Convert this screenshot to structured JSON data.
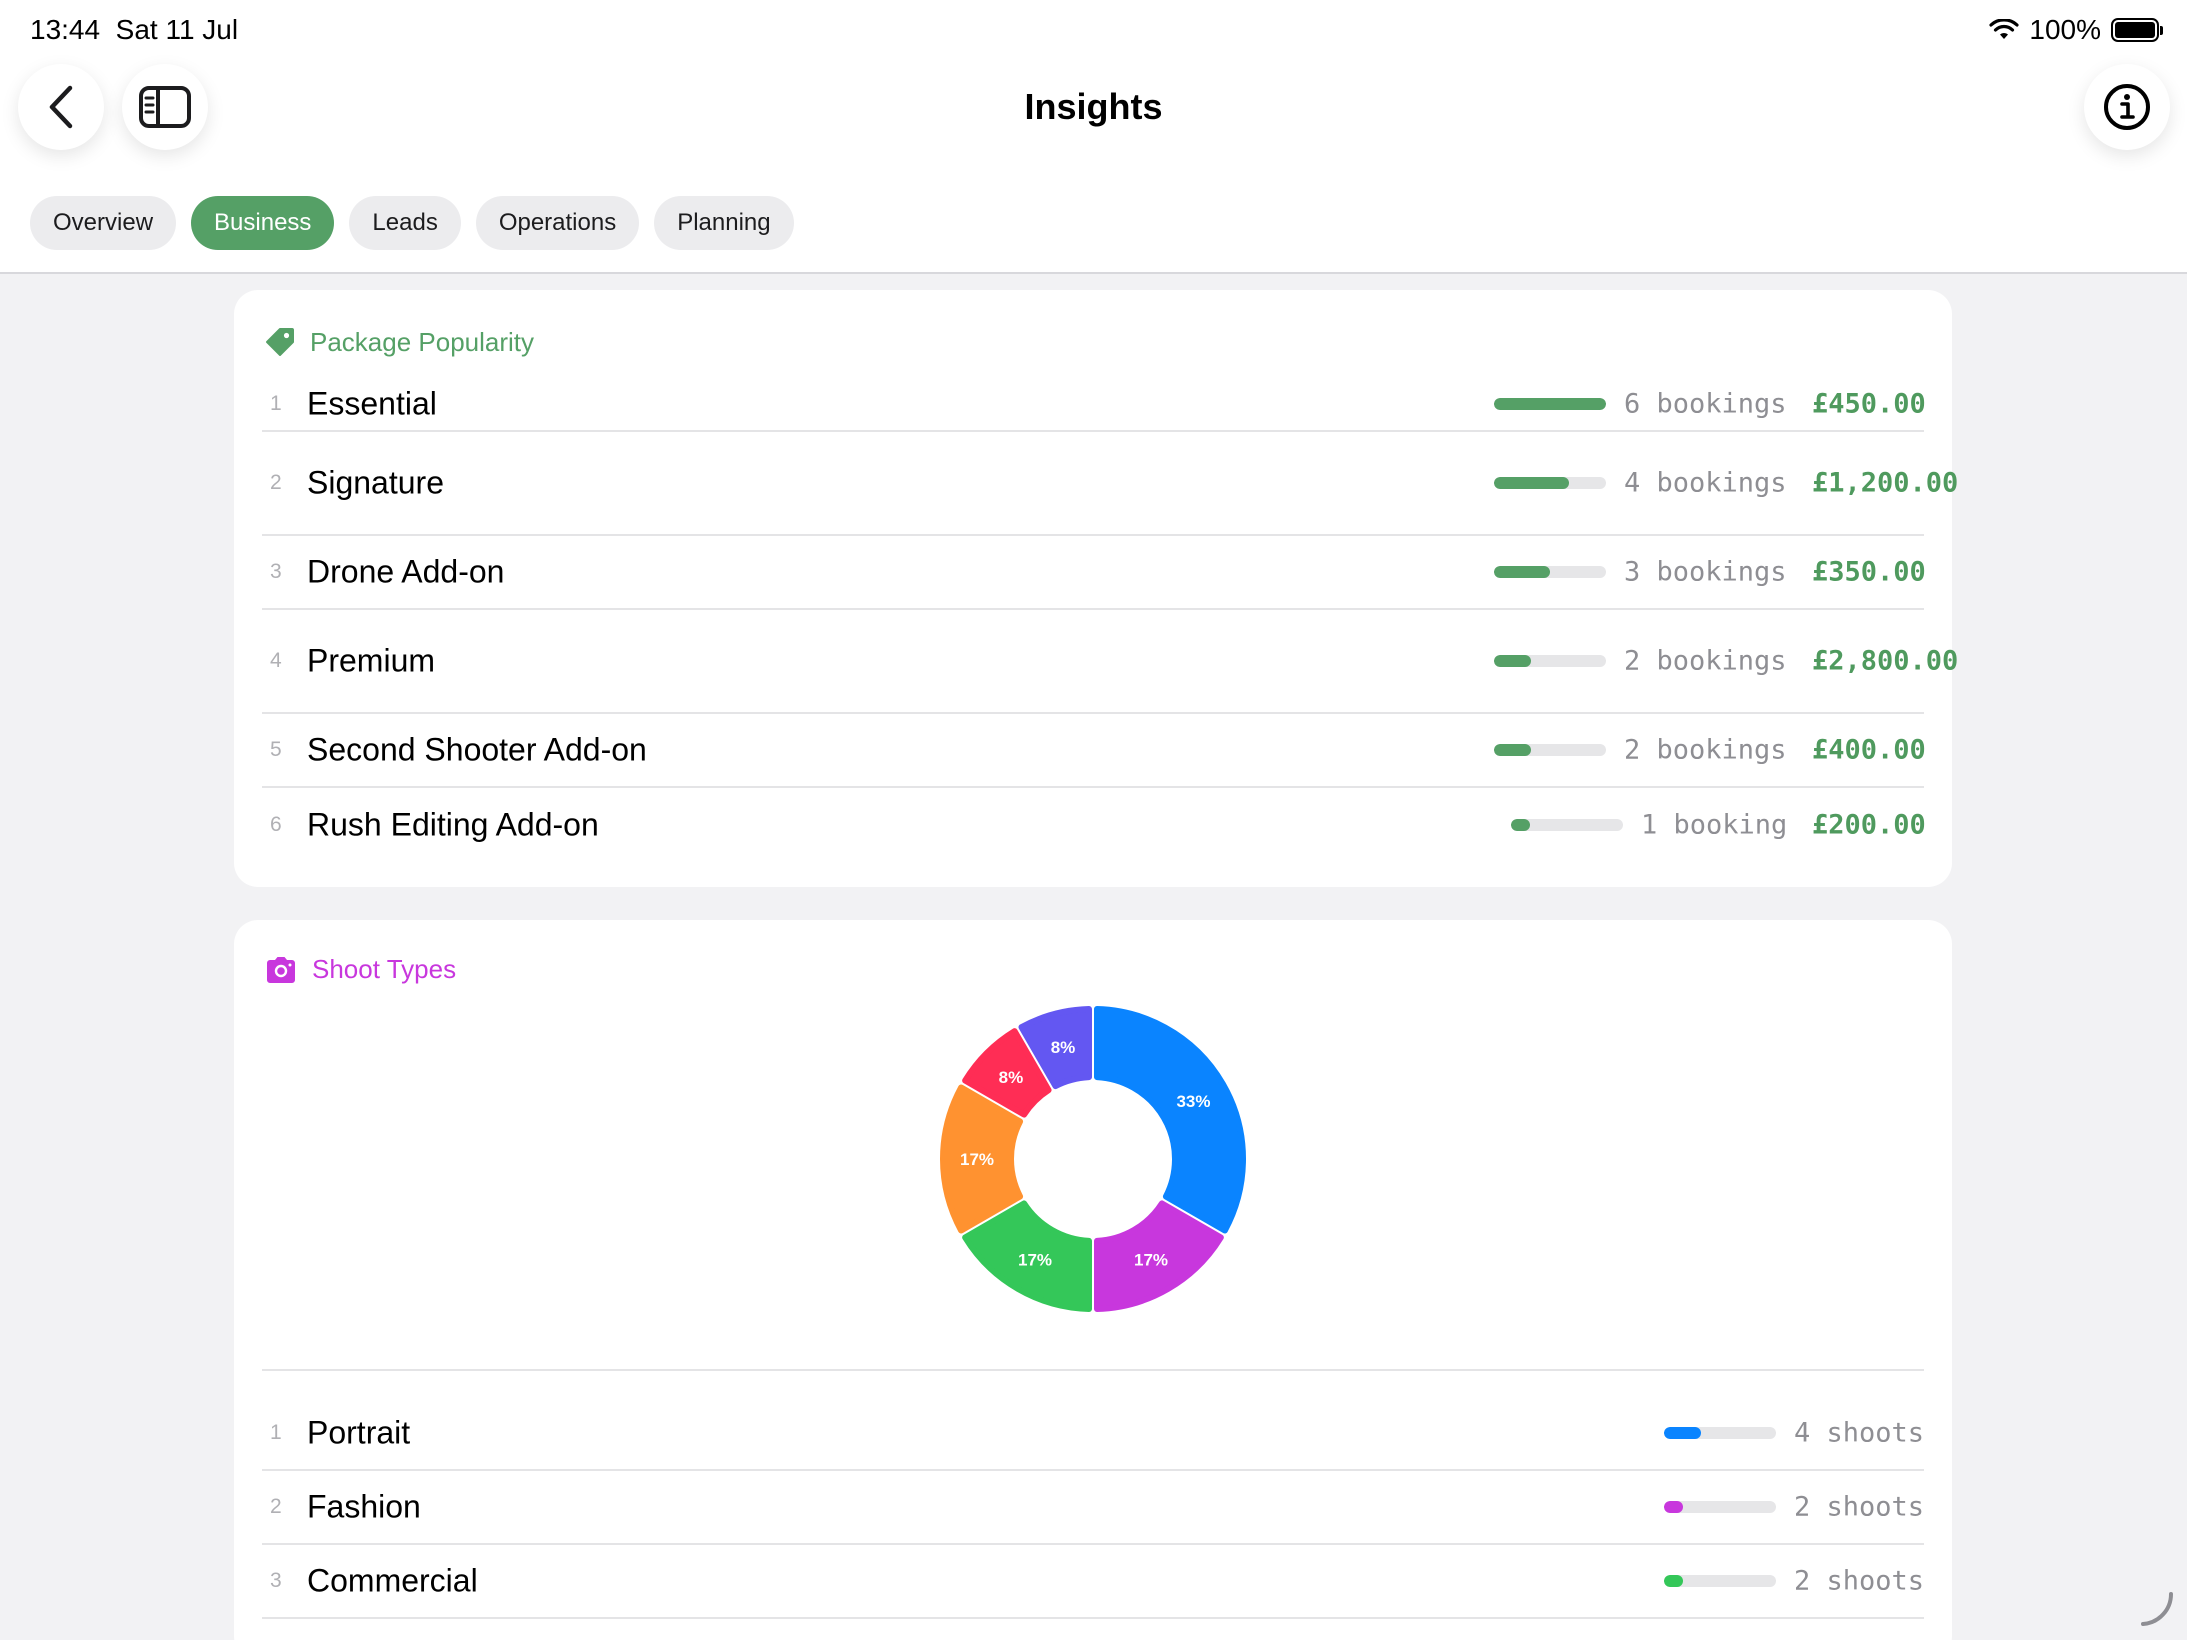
{
  "status_bar": {
    "time": "13:44",
    "date": "Sat 11 Jul",
    "battery": "100%"
  },
  "header": {
    "title": "Insights"
  },
  "tabs": [
    {
      "label": "Overview",
      "active": false
    },
    {
      "label": "Business",
      "active": true
    },
    {
      "label": "Leads",
      "active": false
    },
    {
      "label": "Operations",
      "active": false
    },
    {
      "label": "Planning",
      "active": false
    }
  ],
  "package_popularity": {
    "title": "Package Popularity",
    "accent": "#55a066",
    "rows": [
      {
        "rank": "1",
        "name": "Essential",
        "count": "6 bookings",
        "price": "£450.00",
        "fraction": 1.0
      },
      {
        "rank": "2",
        "name": "Signature",
        "count": "4 bookings",
        "price": "£1,200.00",
        "fraction": 0.667
      },
      {
        "rank": "3",
        "name": "Drone Add-on",
        "count": "3 bookings",
        "price": "£350.00",
        "fraction": 0.5
      },
      {
        "rank": "4",
        "name": "Premium",
        "count": "2 bookings",
        "price": "£2,800.00",
        "fraction": 0.333
      },
      {
        "rank": "5",
        "name": "Second Shooter Add-on",
        "count": "2 bookings",
        "price": "£400.00",
        "fraction": 0.333
      },
      {
        "rank": "6",
        "name": "Rush Editing Add-on",
        "count": "1 booking",
        "price": "£200.00",
        "fraction": 0.167
      }
    ]
  },
  "shoot_types": {
    "title": "Shoot Types",
    "accent": "#c837dd",
    "rows": [
      {
        "rank": "1",
        "name": "Portrait",
        "count": "4 shoots",
        "fraction": 0.333,
        "color": "#0a84ff"
      },
      {
        "rank": "2",
        "name": "Fashion",
        "count": "2 shoots",
        "fraction": 0.167,
        "color": "#c837dd"
      },
      {
        "rank": "3",
        "name": "Commercial",
        "count": "2 shoots",
        "fraction": 0.167,
        "color": "#34c759"
      }
    ]
  },
  "chart_data": {
    "type": "pie",
    "donut": true,
    "values": [
      4,
      2,
      2,
      2,
      1,
      1
    ],
    "labels": [
      "33%",
      "17%",
      "17%",
      "17%",
      "8%",
      "8%"
    ],
    "colors": [
      "#0a84ff",
      "#c837dd",
      "#34c759",
      "#ff9230",
      "#ff2d55",
      "#6357f2"
    ]
  }
}
